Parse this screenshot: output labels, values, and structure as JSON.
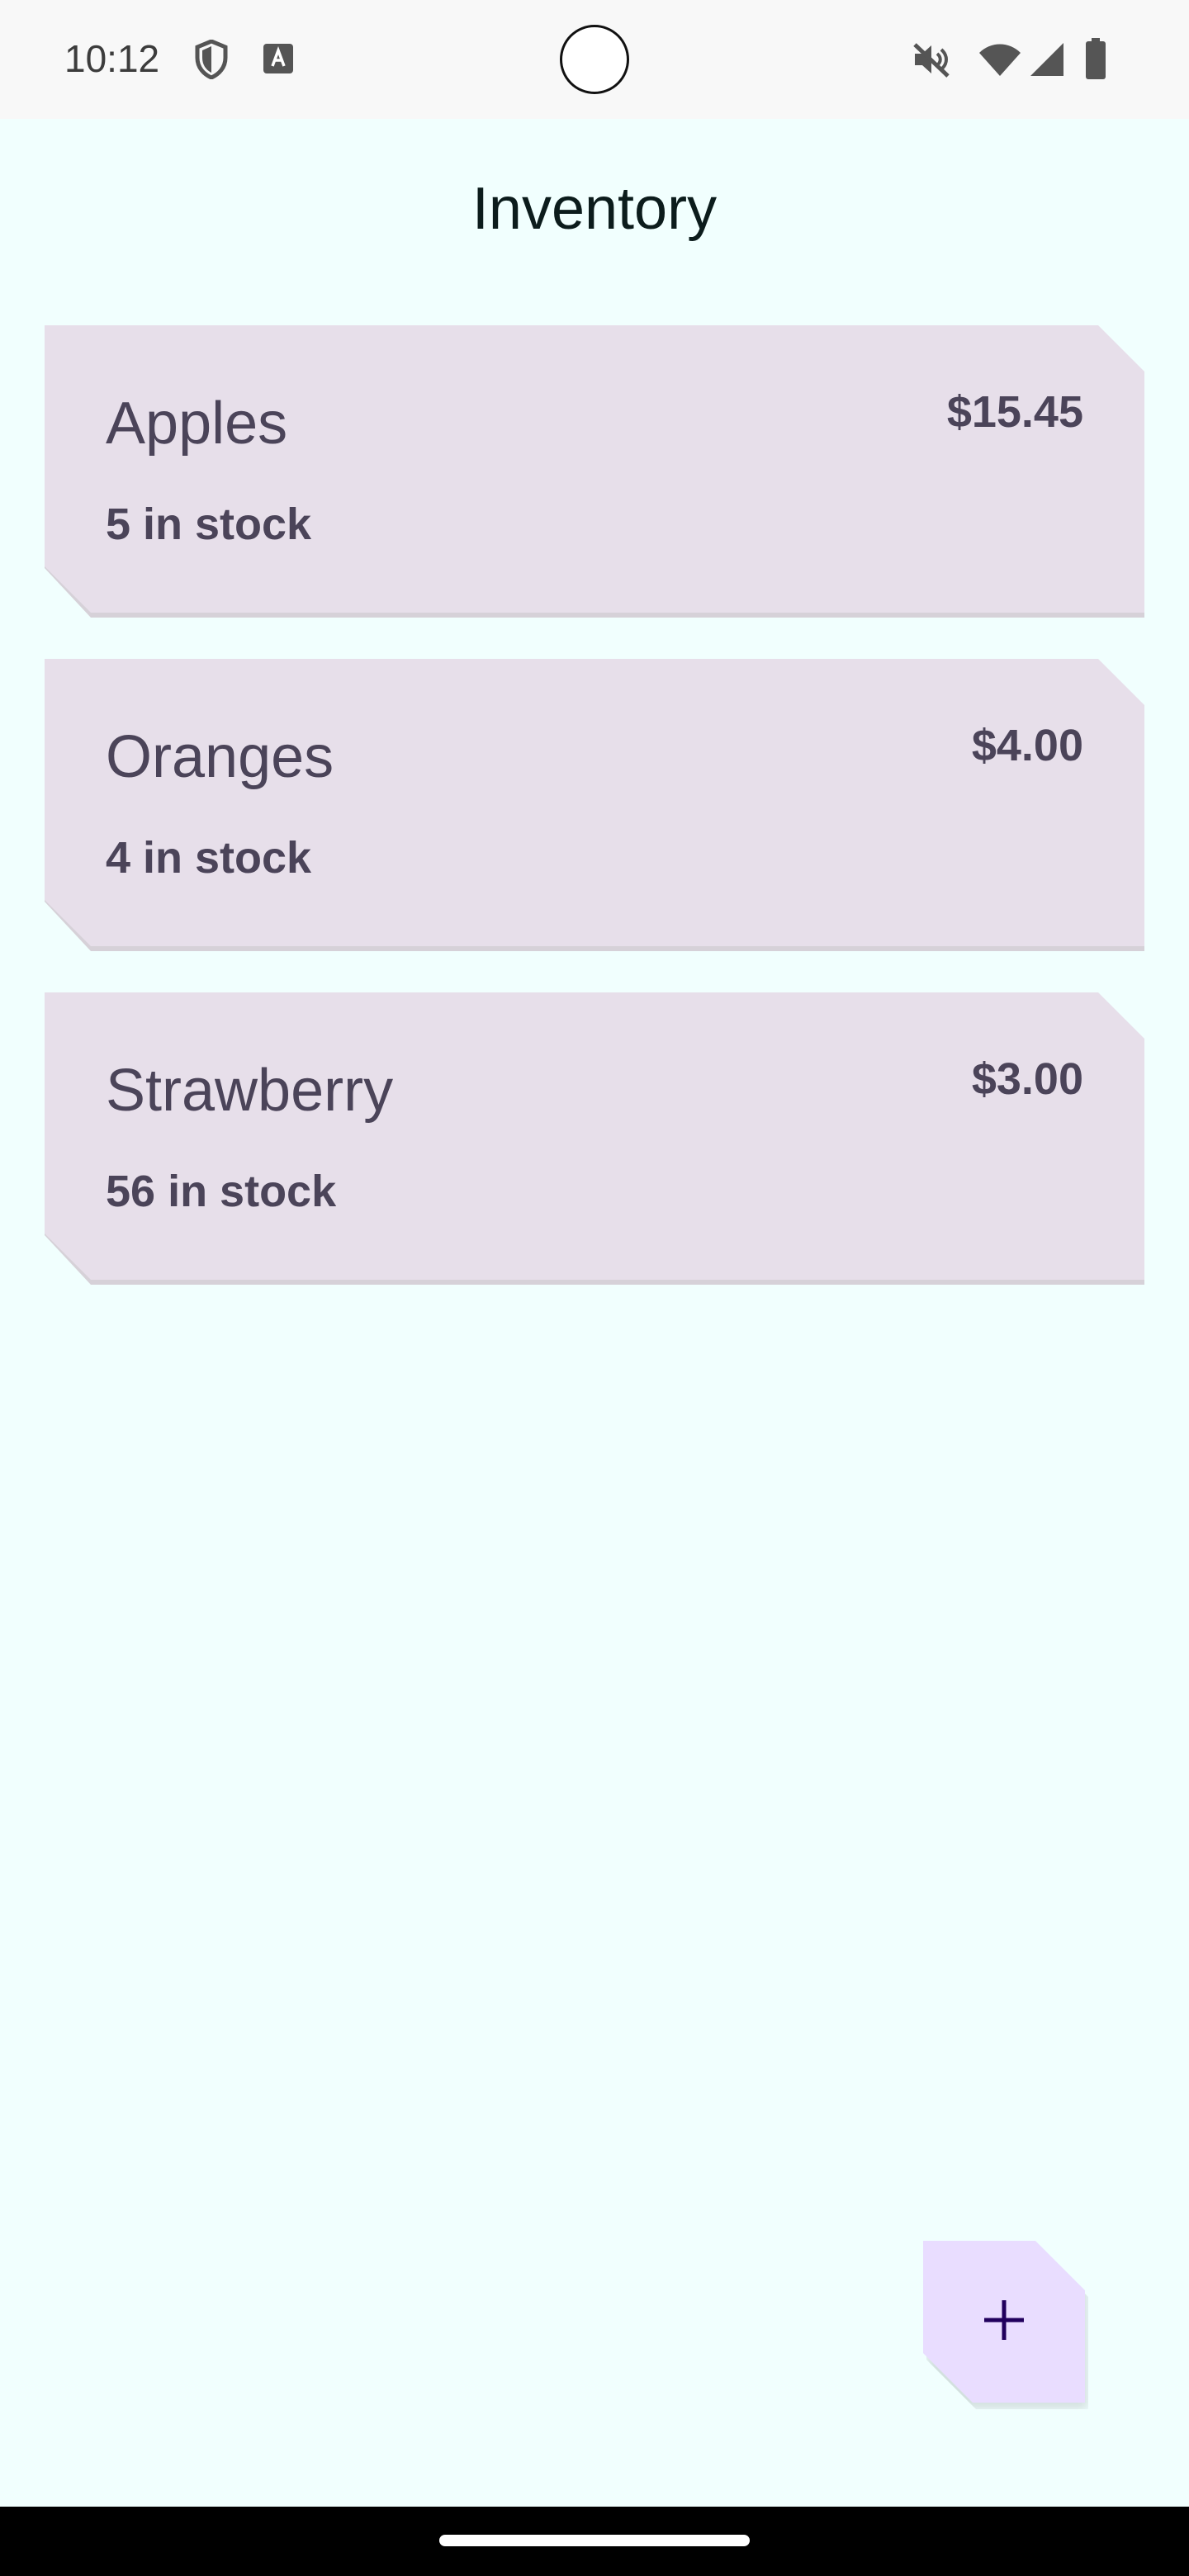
{
  "status_bar": {
    "time": "10:12",
    "icons": [
      "shield-icon",
      "text-a-icon",
      "mute-icon",
      "wifi-icon",
      "signal-icon",
      "battery-icon"
    ]
  },
  "app_bar": {
    "title": "Inventory"
  },
  "items": [
    {
      "name": "Apples",
      "price": "$15.45",
      "stock": "5 in stock"
    },
    {
      "name": "Oranges",
      "price": "$4.00",
      "stock": "4 in stock"
    },
    {
      "name": "Strawberry",
      "price": "$3.00",
      "stock": "56 in stock"
    }
  ],
  "fab": {
    "icon": "plus-icon"
  },
  "colors": {
    "background": "#f1fffe",
    "card": "#e7dfea",
    "card_text": "#4b4459",
    "fab": "#e9ddff",
    "fab_icon": "#21005d"
  }
}
